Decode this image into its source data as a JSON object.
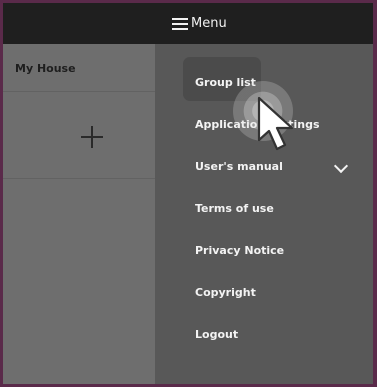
{
  "left": {
    "house_name": "My House"
  },
  "menu": {
    "title": "Menu",
    "items": [
      {
        "label": "Group list"
      },
      {
        "label": "Application settings"
      },
      {
        "label": "User's manual"
      },
      {
        "label": "Terms of use"
      },
      {
        "label": "Privacy Notice"
      },
      {
        "label": "Copyright"
      },
      {
        "label": "Logout"
      }
    ]
  },
  "icons": {
    "menu": "hamburger-icon",
    "add": "plus-icon",
    "expand": "chevron-down-icon",
    "pointer": "cursor-icon"
  }
}
